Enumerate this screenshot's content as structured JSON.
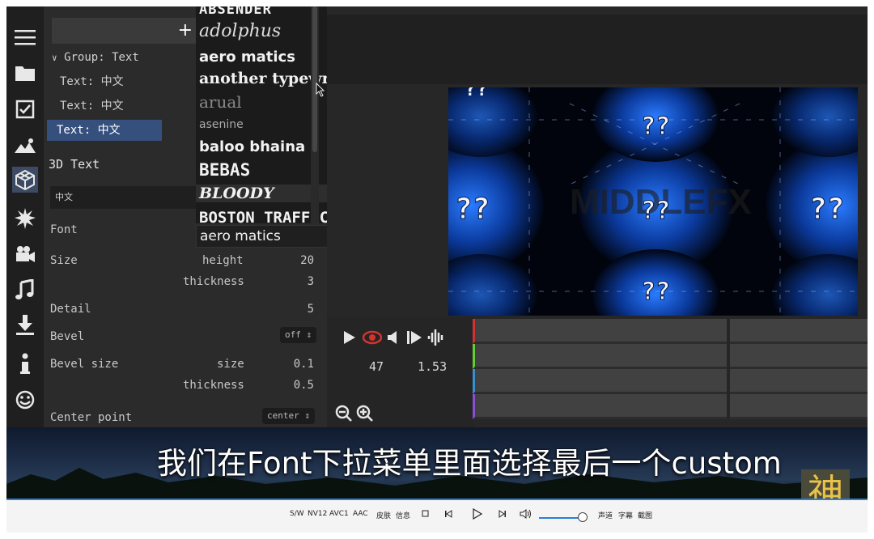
{
  "panel": {
    "add_label": "+",
    "group_label": "Group: Text",
    "layers": [
      "Text: 中文",
      "Text: 中文",
      "Text: 中文"
    ],
    "section_title": "3D Text",
    "text_value": "中文",
    "props": {
      "font_label": "Font",
      "font_value": "aero matics",
      "size_label": "Size",
      "height_label": "height",
      "height_value": "20",
      "thickness_label": "thickness",
      "thickness_value": "3",
      "detail_label": "Detail",
      "detail_value": "5",
      "bevel_label": "Bevel",
      "bevel_value": "off",
      "bevel_size_label": "Bevel size",
      "bevel_size_size_label": "size",
      "bevel_size_size_value": "0.1",
      "bevel_size_thickness_label": "thickness",
      "bevel_size_thickness_value": "0.5",
      "center_label": "Center point",
      "center_value": "center"
    }
  },
  "font_dropdown": {
    "items": [
      "ABSENDER",
      "adolphus",
      "aero matics",
      "another typewri",
      "arual",
      "asenine",
      "baloo bhaina",
      "BEBAS",
      "BLOODY",
      "BOSTON TRAFFIC"
    ]
  },
  "controls": {
    "frame": "47",
    "time": "1.53"
  },
  "preview": {
    "marks": [
      "??",
      "??",
      "??",
      "??",
      "??",
      "??"
    ]
  },
  "subtitle": "我们在Font下拉菜单里面选择最后一个custom",
  "logo_char": "神",
  "player": {
    "items": [
      "S/W",
      "NV12",
      "AVC1",
      "AAC",
      "皮肤",
      "信息",
      "声道",
      "字幕",
      "截图"
    ]
  },
  "colors": {
    "selection": "#36507e",
    "accent": "#2b7fd6",
    "glow": "#1a6cff"
  },
  "icons": [
    "menu-icon",
    "folder-icon",
    "checkbox-icon",
    "image-icon",
    "cube-icon",
    "burst-icon",
    "video-camera-icon",
    "music-icon",
    "download-icon",
    "info-icon",
    "smiley-icon"
  ]
}
